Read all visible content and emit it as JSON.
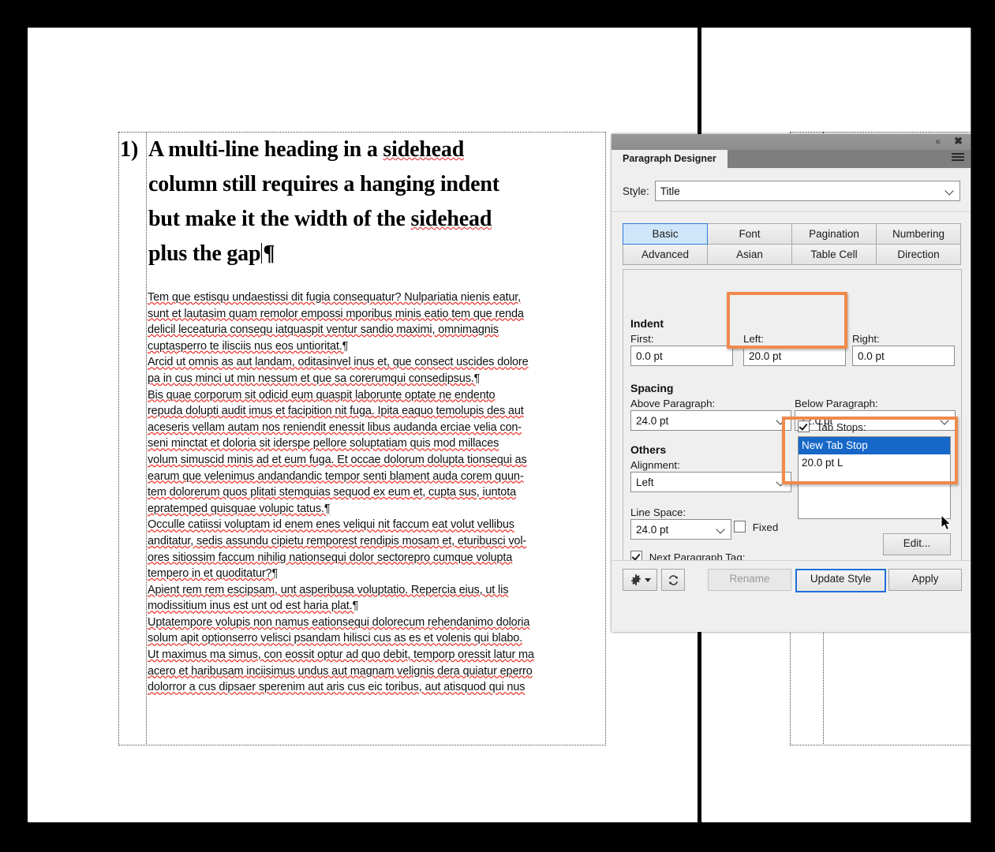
{
  "document": {
    "heading": {
      "number": "1)",
      "lines": [
        "A multi-line heading in a sidehead",
        "column still requires a hanging indent",
        "but make it the width of the sidehead",
        "plus the gap"
      ],
      "pilcrow": "¶"
    },
    "paragraphs": [
      [
        "Tem que estisqu undaestissi dit fugia consequatur? Nulpariatia nienis eatur,",
        "sunt et lautasim quam remolor empossi mporibus minis eatio tem que renda",
        "delicil leceaturia consequ iatquaspit ventur sandio maximi, omnimagnis",
        "cuptasperro te ilisciis nus eos untioritat.¶"
      ],
      [
        "Arcid ut omnis as aut landam, oditasinvel inus et, que consect uscides dolore",
        "pa in cus minci ut min nessum et que sa corerumqui consedipsus.¶"
      ],
      [
        "Bis quae corporum sit odicid eum quaspit laborunte optate ne endento",
        "repuda dolupti audit imus et facipition nit fuga. Ipita eaquo temolupis des aut",
        "aceseris vellam autam nos reniendit enessit libus audanda erciae velia con-",
        "seni minctat et doloria sit iderspe pellore soluptatiam quis mod millaces",
        "volum simuscid minis ad et eum fuga. Et occae dolorum dolupta tionsequi as",
        "earum que velenimus andandandic tempor senti blament auda corem quun-",
        "tem dolorerum quos plitati stemquias sequod ex eum et, cupta sus, iuntota",
        "epratemped quisquae volupic tatus.¶"
      ],
      [
        "Occulle catiissi voluptam id enem enes veliqui nit faccum eat volut vellibus",
        "anditatur, sedis assundu cipietu remporest rendipis mosam et, eturibusci vol-",
        "ores sitiossim faccum nihilig nationsequi dolor sectorepro cumque volupta",
        "tempero in et quoditatur?¶"
      ],
      [
        "Apient rem rem escipsam, unt asperibusa voluptatio. Repercia eius, ut lis",
        "modissitium inus est unt od est haria plat.¶"
      ],
      [
        "Uptatempore volupis non namus eationsequi dolorecum rehendanimo doloria",
        "solum apit optionserro velisci psandam hilisci cus as es et volenis qui blabo.",
        "Ut maximus ma simus, con eossit optur ad quo debit, temporp oressit latur ma",
        "acero et haribusam inciisimus undus aut magnam velignis dera quiatur eperro",
        "dolorror a cus dipsaer sperenim aut aris cus eic toribus, aut atisquod qui nus"
      ]
    ]
  },
  "panel": {
    "titlebar": {
      "collapse_icon": "«",
      "close_icon": "✖"
    },
    "tab_name": "Paragraph Designer",
    "menu_icon": "hamburger-icon",
    "style": {
      "label": "Style:",
      "value": "Title"
    },
    "tabs": [
      {
        "label": "Basic",
        "selected": true
      },
      {
        "label": "Font",
        "selected": false
      },
      {
        "label": "Pagination",
        "selected": false
      },
      {
        "label": "Numbering",
        "selected": false
      },
      {
        "label": "Advanced",
        "selected": false
      },
      {
        "label": "Asian",
        "selected": false
      },
      {
        "label": "Table Cell",
        "selected": false
      },
      {
        "label": "Direction",
        "selected": false
      }
    ],
    "indent": {
      "section": "Indent",
      "first_label": "First:",
      "first_value": "0.0 pt",
      "left_label": "Left:",
      "left_value": "20.0 pt",
      "right_label": "Right:",
      "right_value": "0.0 pt"
    },
    "spacing": {
      "section": "Spacing",
      "above_label": "Above Paragraph:",
      "above_value": "24.0 pt",
      "below_label": "Below Paragraph:",
      "below_value": "12.0 pt"
    },
    "others": {
      "section": "Others",
      "alignment_label": "Alignment:",
      "alignment_value": "Left",
      "line_space_label": "Line Space:",
      "line_space_value": "24.0 pt",
      "fixed_label": "Fixed",
      "fixed_checked": false,
      "next_tag_label": "Next Paragraph Tag:",
      "next_tag_checked": true,
      "next_tag_value": "",
      "tab_stops_label": "Tab Stops:",
      "tab_stops_checked": true,
      "tab_stops_items": [
        {
          "label": "New Tab Stop",
          "selected": true
        },
        {
          "label": "20.0 pt  L",
          "selected": false
        }
      ],
      "edit_button": "Edit..."
    },
    "footer": {
      "gear_icon": "gear-icon",
      "refresh_icon": "refresh-icon",
      "rename_label": "Rename",
      "update_style_label": "Update Style",
      "apply_label": "Apply"
    },
    "highlight_color": "#f08a4b",
    "accent_color": "#1667c8"
  }
}
